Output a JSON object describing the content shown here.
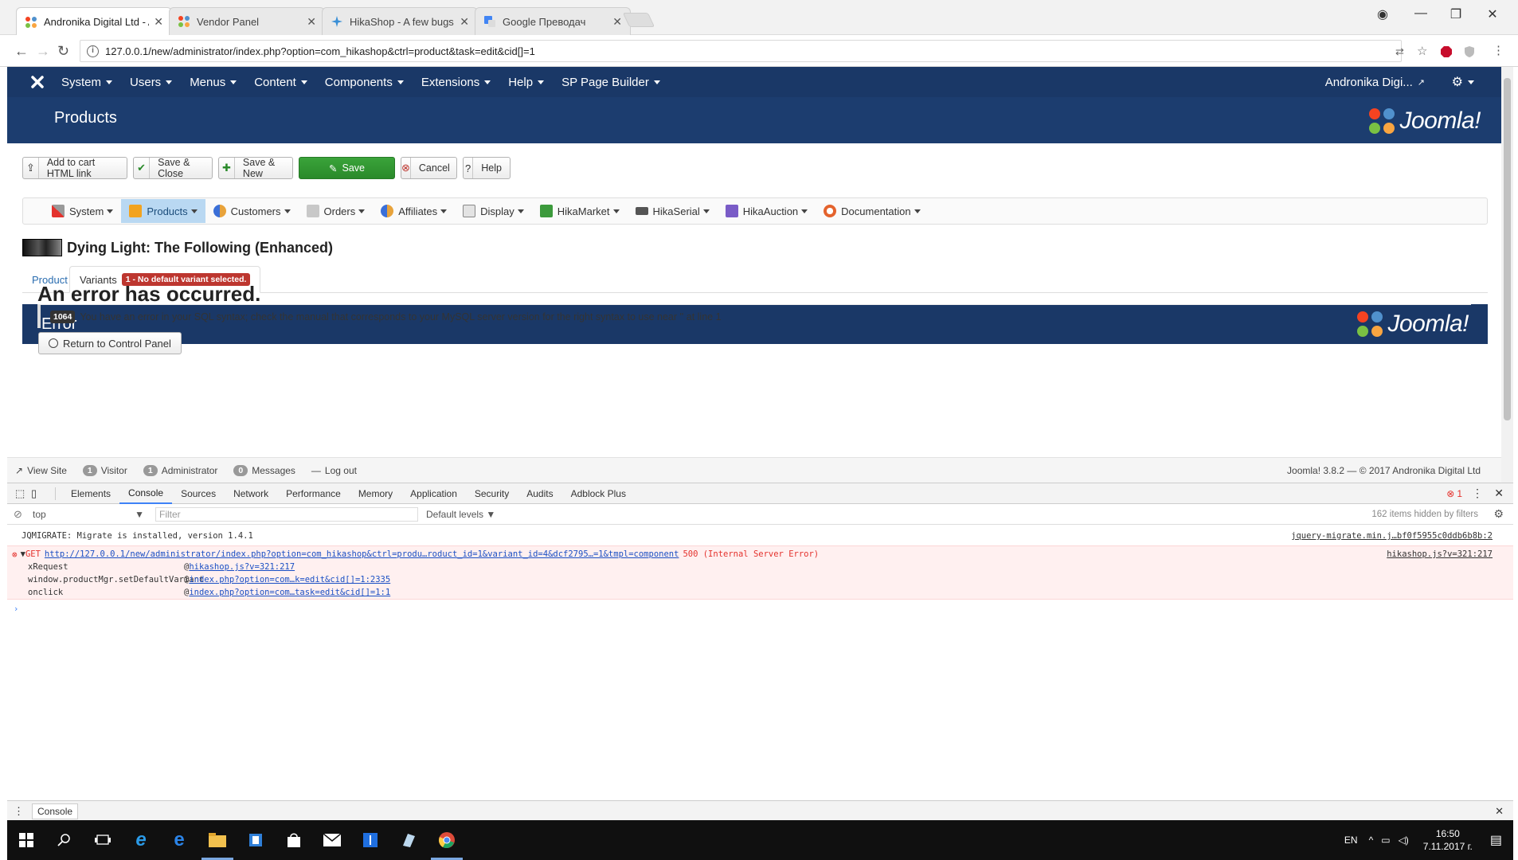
{
  "browser": {
    "tabs": [
      {
        "title": "Andronika Digital Ltd - A",
        "active": true
      },
      {
        "title": "Vendor Panel",
        "active": false
      },
      {
        "title": "HikaShop - A few bugs o",
        "active": false
      },
      {
        "title": "Google Преводач",
        "active": false
      }
    ],
    "url": "127.0.0.1/new/administrator/index.php?option=com_hikashop&ctrl=product&task=edit&cid[]=1"
  },
  "joomla": {
    "nav": {
      "menus": [
        "System",
        "Users",
        "Menus",
        "Content",
        "Components",
        "Extensions",
        "Help",
        "SP Page Builder"
      ],
      "user": "Andronika Digi..."
    },
    "page_title": "Products",
    "brand_word": "Joomla!",
    "toolbar": {
      "add_to_cart": "Add to cart HTML link",
      "save_close": "Save & Close",
      "save_new": "Save & New",
      "save": "Save",
      "cancel": "Cancel",
      "help": "Help"
    },
    "hikamenu": {
      "items": [
        "System",
        "Products",
        "Customers",
        "Orders",
        "Affiliates",
        "Display",
        "HikaMarket",
        "HikaSerial",
        "HikaAuction",
        "Documentation"
      ],
      "active": "Products"
    },
    "product": {
      "name": "Dying Light: The Following (Enhanced)",
      "tab_product": "Product",
      "tab_variants": "Variants",
      "variant_warning": "1 - No default variant selected."
    },
    "error": {
      "bar_title": "Error",
      "heading": "An error has occurred.",
      "code": "1064",
      "message": "You have an error in your SQL syntax; check the manual that corresponds to your MySQL server version for the right syntax to use near '' at line 1",
      "return_label": "Return to Control Panel"
    },
    "status": {
      "view_site": "View Site",
      "visitor_count": "1",
      "visitor_label": "Visitor",
      "admin_count": "1",
      "admin_label": "Administrator",
      "messages_count": "0",
      "messages_label": "Messages",
      "logout": "Log out",
      "version": "Joomla! 3.8.2 — © 2017 Andronika Digital Ltd"
    }
  },
  "devtools": {
    "tabs": [
      "Elements",
      "Console",
      "Sources",
      "Network",
      "Performance",
      "Memory",
      "Application",
      "Security",
      "Audits",
      "Adblock Plus"
    ],
    "active_tab": "Console",
    "error_count": "1",
    "context": "top",
    "filter_placeholder": "Filter",
    "levels": "Default levels",
    "hidden_count": "162 items hidden by filters",
    "log": {
      "text": "JQMIGRATE: Migrate is installed, version 1.4.1",
      "source": "jquery-migrate.min.j…bf0f5955c0ddb6b8b:2"
    },
    "error": {
      "method": "GET",
      "url": "http://127.0.0.1/new/administrator/index.php?option=com_hikashop&ctrl=produ…roduct_id=1&variant_id=4&dcf2795…=1&tmpl=component",
      "status": "500 (Internal Server Error)",
      "source": "hikashop.js?v=321:217",
      "stack": [
        {
          "fn": "xRequest",
          "loc": "hikashop.js?v=321:217"
        },
        {
          "fn": "window.productMgr.setDefaultVariant",
          "loc": "index.php?option=com…k=edit&cid[]=1:2335"
        },
        {
          "fn": "onclick",
          "loc": "index.php?option=com…task=edit&cid[]=1:1"
        }
      ]
    },
    "drawer_tab": "Console"
  },
  "taskbar": {
    "lang": "EN",
    "time": "16:50",
    "date": "7.11.2017 г."
  },
  "colors": {
    "joomla_navy": "#1a3867",
    "save_green": "#2f962f",
    "error_red": "#bd362f"
  }
}
